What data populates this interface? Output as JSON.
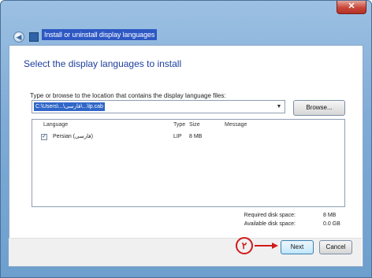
{
  "window": {
    "title": "Install or uninstall display languages",
    "close_icon": "close-icon",
    "back_icon": "back-arrow-icon",
    "app_icon": "language-icon"
  },
  "main": {
    "heading": "Select the display languages to install",
    "path_label": "Type or browse to the location that contains the display language files:",
    "path_value": "C:\\Users\\...\\فارسی\\...\\lp.cab",
    "browse_label": "Browse...",
    "list": {
      "columns": [
        "Language",
        "Type",
        "Size",
        "Message"
      ],
      "rows": [
        {
          "checked": true,
          "language": "Persian (فارسی)",
          "type": "LIP",
          "size": "8 MB",
          "message": ""
        }
      ]
    },
    "required_label": "Required disk space:",
    "required_value": "8 MB",
    "available_label": "Available disk space:",
    "available_value": "0.0 GB"
  },
  "footer": {
    "next_label": "Next",
    "cancel_label": "Cancel",
    "step_marker": "۲"
  },
  "colors": {
    "accent": "#2f66c8",
    "heading": "#1e3f9e",
    "annotation": "#d11a1a"
  }
}
